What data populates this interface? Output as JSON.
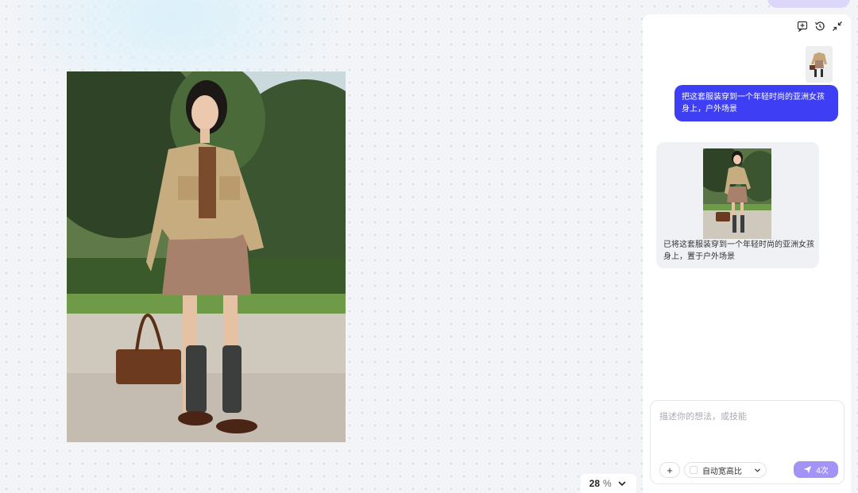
{
  "canvas": {
    "zoom_value": "28",
    "zoom_unit": "%"
  },
  "top_pill": {
    "label": ""
  },
  "chat": {
    "toolbar": {
      "icons": [
        "new-chat-icon",
        "history-icon",
        "collapse-icon"
      ]
    },
    "user_message": {
      "text": "把这套服装穿到一个年轻时尚的亚洲女孩身上，户外场景"
    },
    "ai_message": {
      "text": "已将这套服装穿到一个年轻时尚的亚洲女孩身上，置于户外场景"
    },
    "input": {
      "placeholder": "描述你的想法，或技能",
      "plus_label": "+",
      "ratio_label": "自动宽高比",
      "send_label": "4次"
    }
  },
  "colors": {
    "accent": "#3e3ff5",
    "send": "#a393f7",
    "panel_bg": "#ffffff",
    "canvas_bg": "#f3f4f8"
  }
}
